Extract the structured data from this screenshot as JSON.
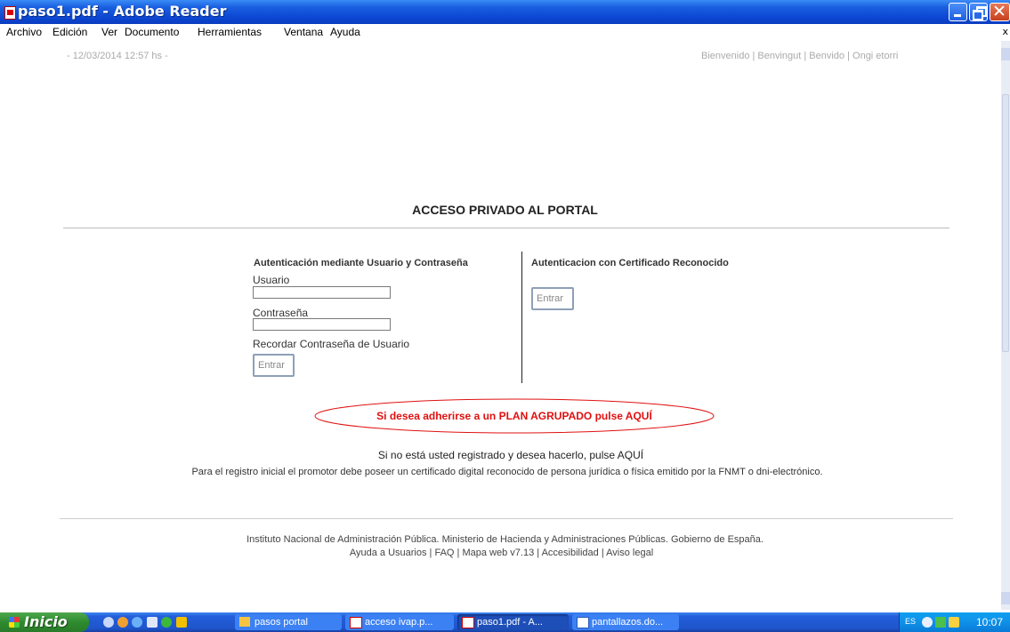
{
  "window": {
    "title": "paso1.pdf - Adobe Reader"
  },
  "menu": {
    "items": [
      "Archivo",
      "Edición",
      "Ver",
      "Documento",
      "Herramientas",
      "Ventana",
      "Ayuda"
    ],
    "close_glyph": "x"
  },
  "page": {
    "date_time": "- 12/03/2014 12:57 hs -",
    "languages": "Bienvenido  |  Benvingut  |  Benvido  |  Ongi etorri",
    "heading": "ACCESO PRIVADO AL PORTAL",
    "login": {
      "title": "Autenticación mediante Usuario y Contraseña",
      "user_label": "Usuario",
      "user_value": "",
      "password_label": "Contraseña",
      "password_value": "",
      "remember_label": "Recordar Contraseña de Usuario",
      "submit_label": "Entrar"
    },
    "certificate": {
      "title": "Autenticacion con Certificado Reconocido",
      "submit_label": "Entrar"
    },
    "plan_link": "Si desea adherirse a un PLAN AGRUPADO pulse AQUÍ",
    "register_text": "Si no está usted registrado y desea hacerlo, pulse AQUÍ",
    "register_note": "Para el registro inicial el promotor debe poseer un certificado digital reconocido de persona jurídica o física emitido por la FNMT o dni-electrónico.",
    "footer_org": "Instituto Nacional de Administración Pública. Ministerio de Hacienda y Administraciones Públicas. Gobierno de España.",
    "footer_links": [
      "Ayuda a Usuarios",
      "FAQ",
      "Mapa web v7.13",
      "Accesibilidad",
      "Aviso legal"
    ],
    "footer_sep": " | "
  },
  "taskbar": {
    "start_label": "Inicio",
    "tasks": [
      {
        "label": "pasos portal",
        "icon": "folder-icon"
      },
      {
        "label": "acceso ivap.p...",
        "icon": "pdf-icon"
      },
      {
        "label": "paso1.pdf - A...",
        "icon": "pdf-icon"
      },
      {
        "label": "pantallazos.do...",
        "icon": "word-icon"
      }
    ],
    "tray_lang": "ES",
    "clock": "10:07"
  },
  "colors": {
    "plan_link": "#e01010",
    "titlebar": "#0d48d4",
    "taskbar": "#245edb",
    "start_button": "#2e8b2e"
  }
}
